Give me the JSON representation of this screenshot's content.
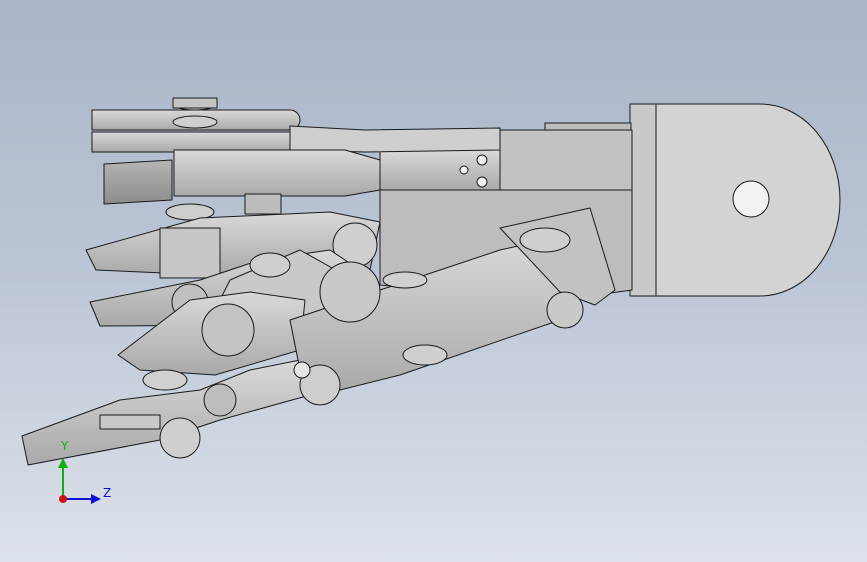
{
  "viewport": {
    "background_top": "#aab6c8",
    "background_bottom": "#dde2ea",
    "model_face_color": "#c8c8c8",
    "model_edge_color": "#1a1a1a"
  },
  "triad": {
    "y_label": "Y",
    "z_label": "Z",
    "y_color": "#10b010",
    "z_color": "#1010d0",
    "x_color": "#d01010"
  }
}
